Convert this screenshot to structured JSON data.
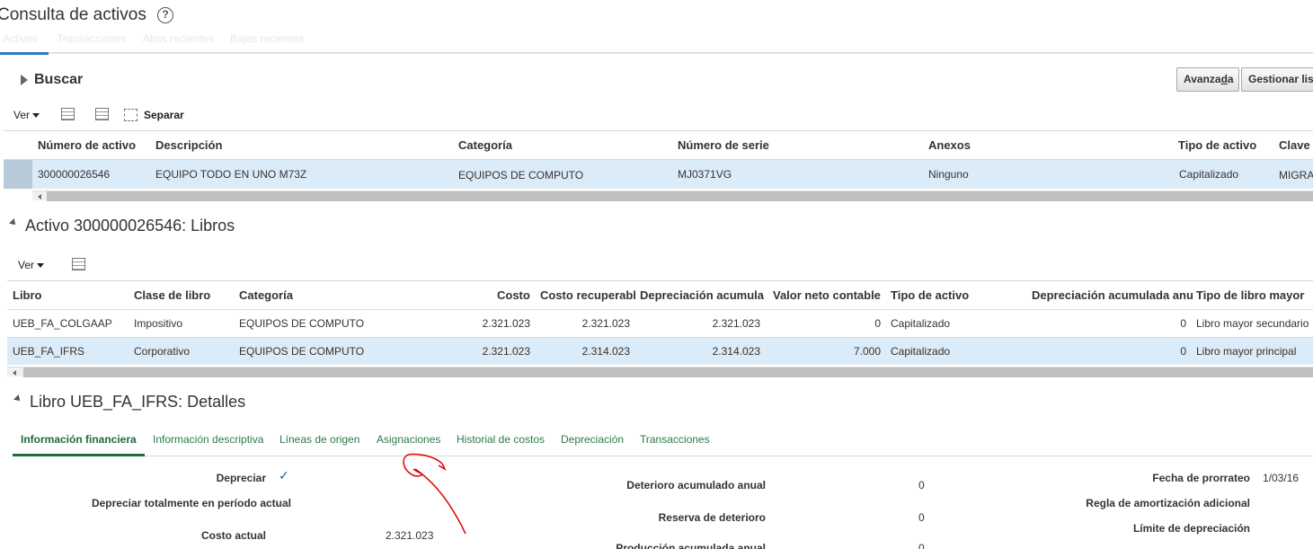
{
  "page": {
    "title": "Consulta de activos",
    "tabs": [
      "Activos",
      "Transacciones",
      "Altas recientes",
      "Bajas recientes"
    ]
  },
  "search": {
    "title": "Buscar",
    "advanced_label_prefix": "Avanza",
    "advanced_label_underlined": "d",
    "advanced_label_suffix": "a",
    "manage_label": "Gestionar lis"
  },
  "assets_toolbar": {
    "view_label": "Ver",
    "detach_label": "Separar"
  },
  "assets_table": {
    "columns": [
      "Número de activo",
      "Descripción",
      "Categoría",
      "Número de serie",
      "Anexos",
      "Tipo de activo",
      "Clave"
    ],
    "rows": [
      [
        "300000026546",
        "EQUIPO TODO EN UNO M73Z",
        "EQUIPOS DE COMPUTO",
        "MJ0371VG",
        "Ninguno",
        "Capitalizado",
        "MIGRA"
      ]
    ]
  },
  "books_section": {
    "title": "Activo 300000026546: Libros",
    "view_label": "Ver"
  },
  "books_table": {
    "columns": [
      "Libro",
      "Clase de libro",
      "Categoría",
      "Costo",
      "Costo recuperabl",
      "Depreciación acumula",
      "Valor neto contable",
      "Tipo de activo",
      "Depreciación acumulada anu",
      "Tipo de libro mayor"
    ],
    "rows": [
      [
        "UEB_FA_COLGAAP",
        "Impositivo",
        "EQUIPOS DE COMPUTO",
        "2.321.023",
        "2.321.023",
        "2.321.023",
        "0",
        "Capitalizado",
        "0",
        "Libro mayor secundario"
      ],
      [
        "UEB_FA_IFRS",
        "Corporativo",
        "EQUIPOS DE COMPUTO",
        "2.321.023",
        "2.314.023",
        "2.314.023",
        "7.000",
        "Capitalizado",
        "0",
        "Libro mayor principal"
      ]
    ]
  },
  "details_section": {
    "title": "Libro UEB_FA_IFRS: Detalles",
    "tabs": [
      "Información financiera",
      "Información descriptiva",
      "Líneas de origen",
      "Asignaciones",
      "Historial de costos",
      "Depreciación",
      "Transacciones"
    ]
  },
  "details": {
    "left": [
      {
        "label": "Depreciar",
        "value": "✓"
      },
      {
        "label": "Depreciar totalmente en período actual",
        "value": "—"
      },
      {
        "label": "Costo actual",
        "value": "2.321.023"
      }
    ],
    "middle": [
      {
        "label": "Deterioro acumulado anual",
        "value": "0"
      },
      {
        "label": "Reserva de deterioro",
        "value": "0"
      },
      {
        "label": "Producción acumulada anual",
        "value": "0"
      }
    ],
    "right": [
      {
        "label": "Fecha de prorrateo",
        "value": "1/03/16"
      },
      {
        "label": "Regla de amortización adicional",
        "value": ""
      },
      {
        "label": "Límite de depreciación",
        "value": ""
      }
    ]
  },
  "colors": {
    "accent": "#2e7bc4",
    "tab_green": "#2b7a4b",
    "selection": "#dcebf8",
    "annotation": "#e00000"
  }
}
